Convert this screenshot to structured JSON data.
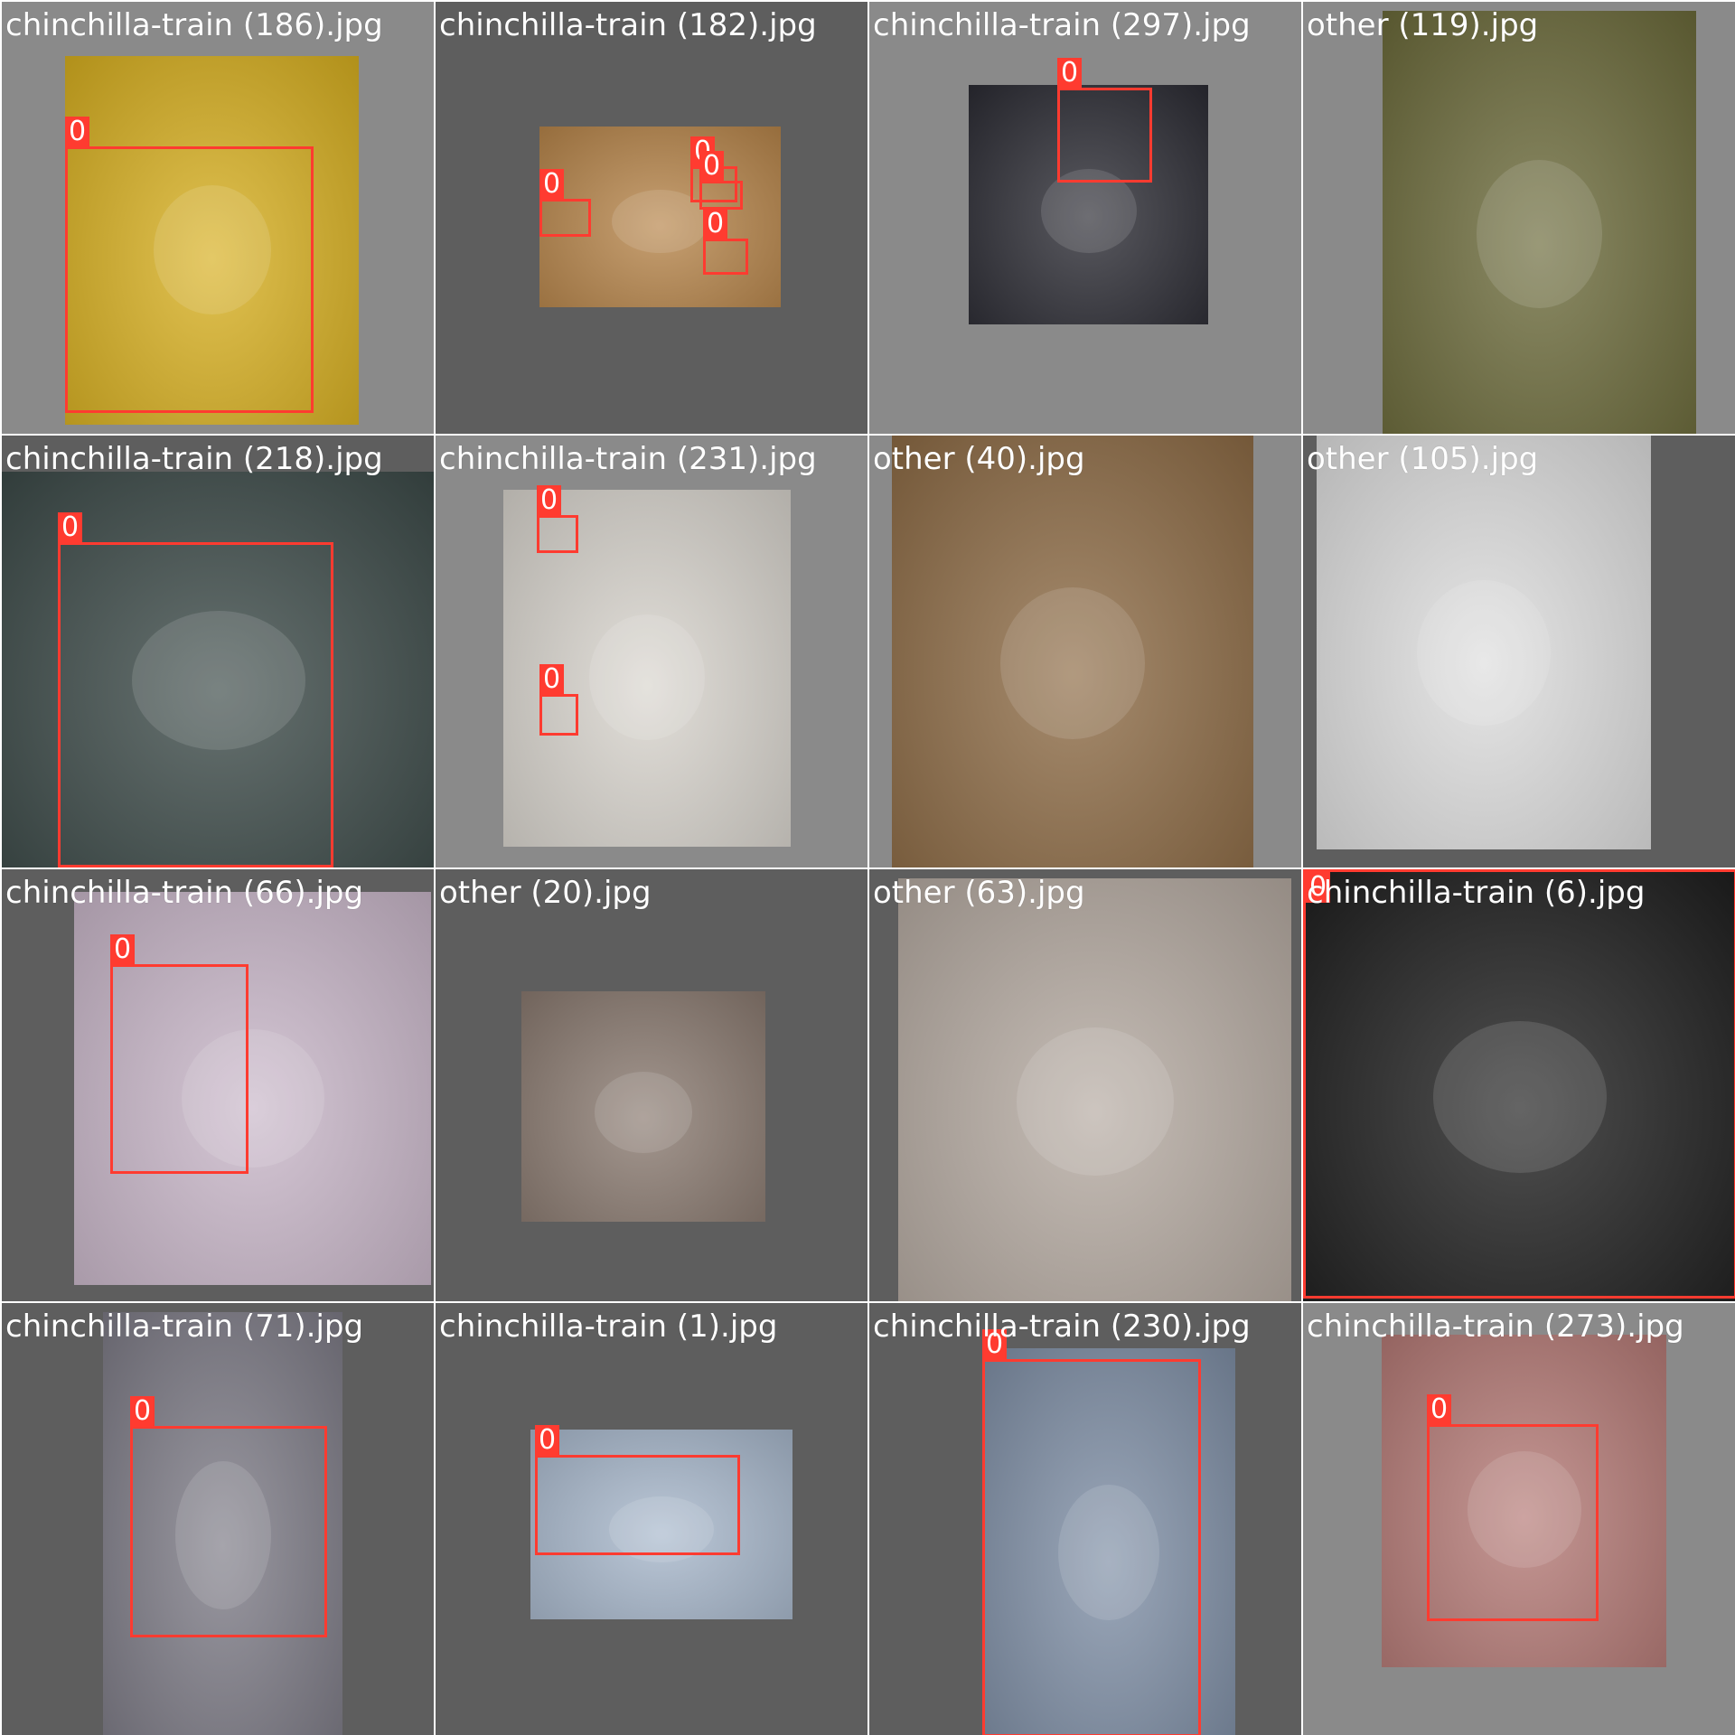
{
  "tiles": [
    {
      "filename": "chinchilla-train (186).jpg",
      "boxes": [
        {
          "label": "0"
        }
      ],
      "bg": "#8a8a8a",
      "photo": "#d8b020"
    },
    {
      "filename": "chinchilla-train (182).jpg",
      "boxes": [
        {
          "label": "0"
        },
        {
          "label": "0"
        },
        {
          "label": "0"
        },
        {
          "label": "0"
        }
      ],
      "bg": "#5e5e5e",
      "photo": "#b7854a"
    },
    {
      "filename": "chinchilla-train (297).jpg",
      "boxes": [
        {
          "label": "0"
        }
      ],
      "bg": "#8a8a8a",
      "photo": "#2b2b33"
    },
    {
      "filename": "other (119).jpg",
      "boxes": [],
      "bg": "#8a8a8a",
      "photo": "#6b6a3a"
    },
    {
      "filename": "chinchilla-train (218).jpg",
      "boxes": [
        {
          "label": "0"
        }
      ],
      "bg": "#5e5e5e",
      "photo": "#3c4a48"
    },
    {
      "filename": "chinchilla-train (231).jpg",
      "boxes": [
        {
          "label": "0"
        },
        {
          "label": "0"
        }
      ],
      "bg": "#8a8a8a",
      "photo": "#d9d5ce"
    },
    {
      "filename": "other (40).jpg",
      "boxes": [],
      "bg": "#8a8a8a",
      "photo": "#8d6b45"
    },
    {
      "filename": "other (105).jpg",
      "boxes": [],
      "bg": "#5e5e5e",
      "photo": "#dedede"
    },
    {
      "filename": "chinchilla-train (66).jpg",
      "boxes": [
        {
          "label": "0"
        }
      ],
      "bg": "#5e5e5e",
      "photo": "#c9b7c9"
    },
    {
      "filename": "other (20).jpg",
      "boxes": [],
      "bg": "#5e5e5e",
      "photo": "#8a7a70"
    },
    {
      "filename": "other (63).jpg",
      "boxes": [],
      "bg": "#5e5e5e",
      "photo": "#b5aaa1"
    },
    {
      "filename": "chinchilla-train (6).jpg",
      "boxes": [
        {
          "label": "0"
        }
      ],
      "bg": "#5e5e5e",
      "photo": "#1e1e1e"
    },
    {
      "filename": "chinchilla-train (71).jpg",
      "boxes": [
        {
          "label": "0"
        }
      ],
      "bg": "#5e5e5e",
      "photo": "#7d7b86"
    },
    {
      "filename": "chinchilla-train (1).jpg",
      "boxes": [
        {
          "label": "0"
        }
      ],
      "bg": "#5e5e5e",
      "photo": "#a8b8cc"
    },
    {
      "filename": "chinchilla-train (230).jpg",
      "boxes": [
        {
          "label": "0"
        }
      ],
      "bg": "#5e5e5e",
      "photo": "#7f8fa6"
    },
    {
      "filename": "chinchilla-train (273).jpg",
      "boxes": [
        {
          "label": "0"
        }
      ],
      "bg": "#8a8a8a",
      "photo": "#b57a76"
    }
  ],
  "colors": {
    "box": "#ff3b30",
    "label_text": "#ffffff"
  }
}
